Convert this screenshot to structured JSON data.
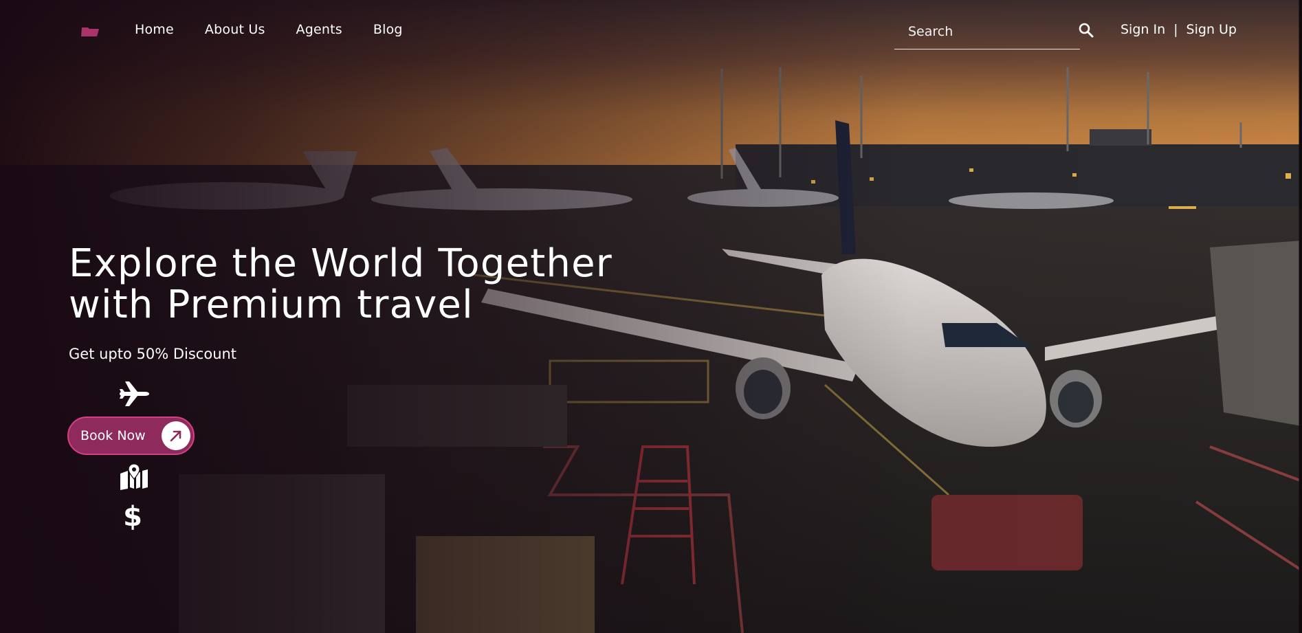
{
  "nav": {
    "logo_icon": "folder-icon",
    "links": [
      "Home",
      "About Us",
      "Agents",
      "Blog"
    ],
    "search_placeholder": "Search",
    "search_icon": "search-icon",
    "sign_in": "Sign In",
    "separator": "|",
    "sign_up": "Sign Up"
  },
  "hero": {
    "headline_line1": "Explore the World Together",
    "headline_line2": "with Premium travel",
    "subline": "Get upto 50% Discount",
    "plane_icon": "plane-icon",
    "book_label": "Book Now",
    "book_icon": "arrow-up-right-icon",
    "map_icon": "map-icon",
    "dollar_symbol": "$"
  },
  "colors": {
    "accent": "#8e2a5c",
    "accent_border": "#d83e83",
    "logo": "#a8346a"
  }
}
